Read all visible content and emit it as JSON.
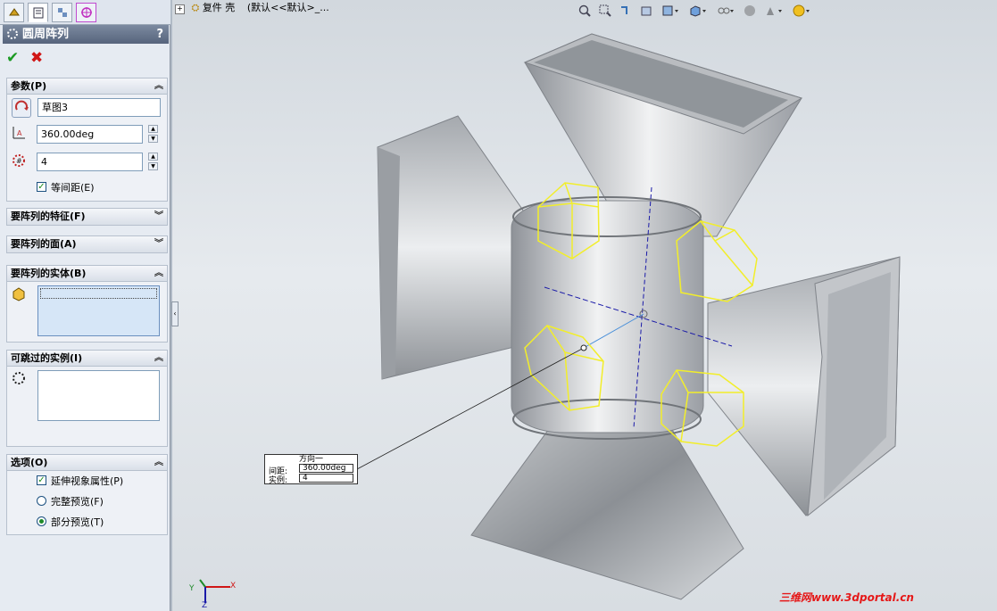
{
  "tabs": [
    {
      "icon": "feature-manager-icon"
    },
    {
      "icon": "property-manager-icon"
    },
    {
      "icon": "configuration-manager-icon"
    },
    {
      "icon": "dimxpert-icon"
    }
  ],
  "panel": {
    "title": "圆周阵列",
    "help": "?",
    "ok": "✔",
    "cancel": "✖"
  },
  "parameters": {
    "header": "参数(P)",
    "direction": "草图3",
    "angle": "360.00deg",
    "instances": "4",
    "equal_spacing_label": "等间距(E)",
    "equal_spacing_checked": true
  },
  "features_to_pattern": {
    "header": "要阵列的特征(F)"
  },
  "faces_to_pattern": {
    "header": "要阵列的面(A)"
  },
  "bodies_to_pattern": {
    "header": "要阵列的实体(B)"
  },
  "instances_to_skip": {
    "header": "可跳过的实例(I)"
  },
  "options": {
    "header": "选项(O)",
    "items": [
      {
        "label": "延伸视象属性(P)",
        "type": "checkbox",
        "checked": true
      },
      {
        "label": "完整预览(F)",
        "type": "radio",
        "checked": false
      },
      {
        "label": "部分预览(T)",
        "type": "radio",
        "checked": true
      }
    ]
  },
  "tree": {
    "label": "复件 壳",
    "config": "(默认<<默认>_..."
  },
  "callout": {
    "title": "方向一",
    "spacing_label": "间距:",
    "spacing_value": "360.00deg",
    "instances_label": "实例:",
    "instances_value": "4"
  },
  "triad": {
    "x": "X",
    "y": "Y",
    "z": "Z"
  },
  "watermark": "三维网www.3dportal.cn",
  "colors": {
    "accent": "#56647c",
    "selection": "#f2ee2a",
    "axis": "#1a1aa8",
    "ok": "#1b9a23",
    "cancel": "#d01616"
  }
}
